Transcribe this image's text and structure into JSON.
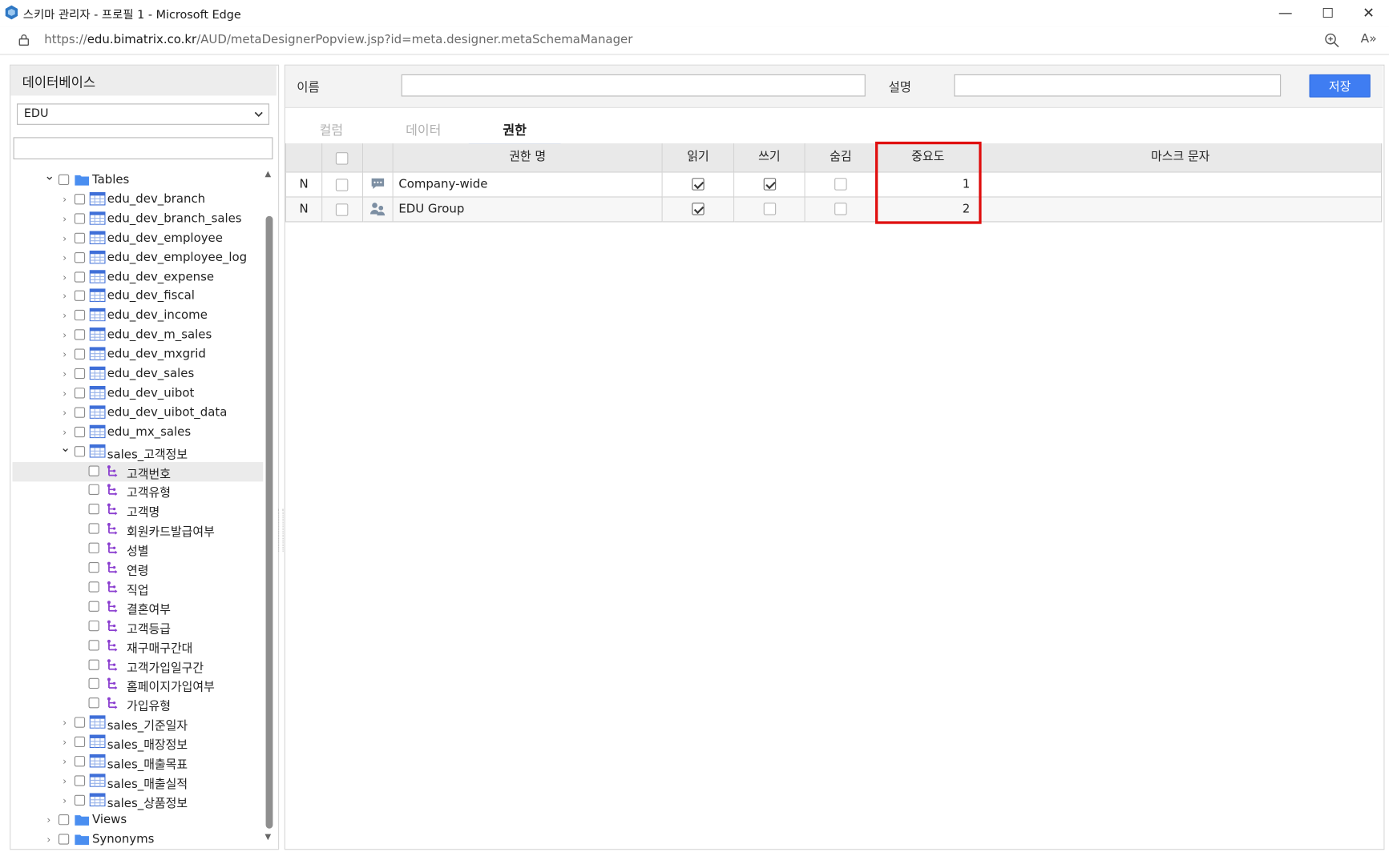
{
  "window": {
    "title": "스키마 관리자 - 프로필 1 - Microsoft Edge",
    "minimize": "—",
    "maximize": "☐",
    "close": "✕"
  },
  "address_bar": {
    "url_prefix": "https://",
    "url_host": "edu.bimatrix.co.kr",
    "url_path": "/AUD/metaDesignerPopview.jsp?id=meta.designer.metaSchemaManager",
    "read_aloud": "A»"
  },
  "left_panel": {
    "title": "데이터베이스",
    "db_selected": "EDU",
    "search_value": "",
    "tree": [
      {
        "label": "Tables",
        "type": "folder",
        "level": 0,
        "expanded": true
      },
      {
        "label": "edu_dev_branch",
        "type": "table",
        "level": 1
      },
      {
        "label": "edu_dev_branch_sales",
        "type": "table",
        "level": 1
      },
      {
        "label": "edu_dev_employee",
        "type": "table",
        "level": 1
      },
      {
        "label": "edu_dev_employee_log",
        "type": "table",
        "level": 1
      },
      {
        "label": "edu_dev_expense",
        "type": "table",
        "level": 1
      },
      {
        "label": "edu_dev_fiscal",
        "type": "table",
        "level": 1
      },
      {
        "label": "edu_dev_income",
        "type": "table",
        "level": 1
      },
      {
        "label": "edu_dev_m_sales",
        "type": "table",
        "level": 1
      },
      {
        "label": "edu_dev_mxgrid",
        "type": "table",
        "level": 1
      },
      {
        "label": "edu_dev_sales",
        "type": "table",
        "level": 1
      },
      {
        "label": "edu_dev_uibot",
        "type": "table",
        "level": 1
      },
      {
        "label": "edu_dev_uibot_data",
        "type": "table",
        "level": 1
      },
      {
        "label": "edu_mx_sales",
        "type": "table",
        "level": 1
      },
      {
        "label": "sales_고객정보",
        "type": "table",
        "level": 1,
        "expanded": true
      },
      {
        "label": "고객번호",
        "type": "column",
        "level": 2,
        "selected": true
      },
      {
        "label": "고객유형",
        "type": "column",
        "level": 2
      },
      {
        "label": "고객명",
        "type": "column",
        "level": 2
      },
      {
        "label": "회원카드발급여부",
        "type": "column",
        "level": 2
      },
      {
        "label": "성별",
        "type": "column",
        "level": 2
      },
      {
        "label": "연령",
        "type": "column",
        "level": 2
      },
      {
        "label": "직업",
        "type": "column",
        "level": 2
      },
      {
        "label": "결혼여부",
        "type": "column",
        "level": 2
      },
      {
        "label": "고객등급",
        "type": "column",
        "level": 2
      },
      {
        "label": "재구매구간대",
        "type": "column",
        "level": 2
      },
      {
        "label": "고객가입일구간",
        "type": "column",
        "level": 2
      },
      {
        "label": "홈페이지가입여부",
        "type": "column",
        "level": 2
      },
      {
        "label": "가입유형",
        "type": "column",
        "level": 2
      },
      {
        "label": "sales_기준일자",
        "type": "table",
        "level": 1
      },
      {
        "label": "sales_매장정보",
        "type": "table",
        "level": 1
      },
      {
        "label": "sales_매출목표",
        "type": "table",
        "level": 1
      },
      {
        "label": "sales_매출실적",
        "type": "table",
        "level": 1
      },
      {
        "label": "sales_상품정보",
        "type": "table",
        "level": 1
      },
      {
        "label": "Views",
        "type": "folder",
        "level": 0
      },
      {
        "label": "Synonyms",
        "type": "folder",
        "level": 0
      }
    ]
  },
  "form": {
    "name_label": "이름",
    "name_value": "",
    "desc_label": "설명",
    "desc_value": "",
    "save_label": "저장"
  },
  "tabs": [
    {
      "label": "컬럼",
      "active": false
    },
    {
      "label": "데이터",
      "active": false
    },
    {
      "label": "권한",
      "active": true
    }
  ],
  "grid": {
    "headers": {
      "name": "권한 명",
      "read": "읽기",
      "write": "쓰기",
      "hide": "숨김",
      "importance": "중요도",
      "mask": "마스크 문자"
    },
    "rows": [
      {
        "status": "N",
        "type_icon": "chat-icon",
        "name": "Company-wide",
        "read": true,
        "write": true,
        "hide": false,
        "importance": "1",
        "mask": ""
      },
      {
        "status": "N",
        "type_icon": "group-icon",
        "name": "EDU Group",
        "read": true,
        "write": false,
        "hide": false,
        "importance": "2",
        "mask": ""
      }
    ]
  },
  "colors": {
    "accent": "#3f7df2",
    "highlight": "#e01010",
    "column_icon": "#8b3fd0",
    "folder": "#4a8ef0"
  }
}
